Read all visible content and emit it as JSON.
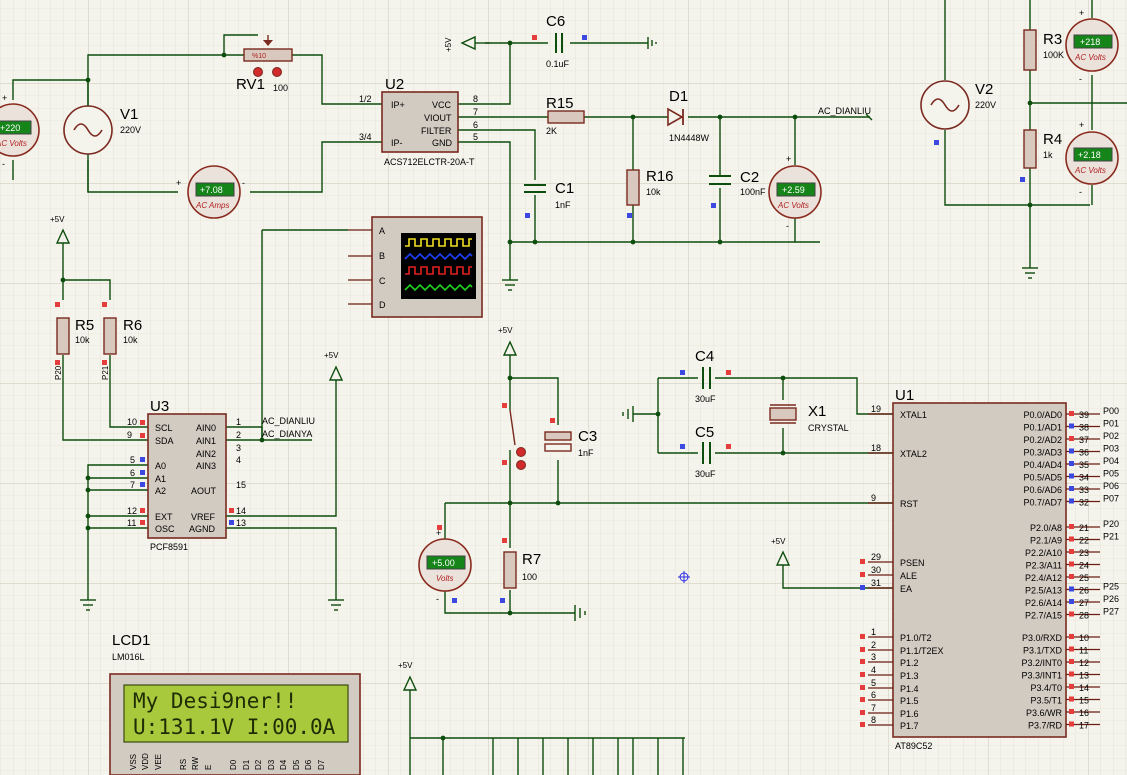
{
  "grid": {
    "minor_color": "#ddd9cc",
    "major_color": "#c9c4b4",
    "background": "#f5f4ec"
  },
  "colors": {
    "wire": "#0d4d0d",
    "component_border": "#7a2a20",
    "component_fill": "#d2cbc2",
    "pin_red": "#e53c3c",
    "pin_blue": "#3b49e0",
    "lcd_green": "#a9c93c",
    "meter_display": "#15851a"
  },
  "u2": {
    "ref": "U2",
    "part": "ACS712ELCTR-20A-T",
    "left_pins": [
      "IP+",
      "IP-"
    ],
    "left_pin_nums": [
      "1/2",
      "3/4"
    ],
    "right_pins": [
      "VCC",
      "VIOUT",
      "FILTER",
      "GND"
    ],
    "right_pin_nums": [
      "8",
      "7",
      "6",
      "5"
    ]
  },
  "u3": {
    "ref": "U3",
    "part": "PCF8591",
    "left_pins": [
      "SCL",
      "SDA",
      "A0",
      "A1",
      "A2",
      "EXT",
      "OSC"
    ],
    "left_pin_nums": [
      "10",
      "9",
      "5",
      "6",
      "7",
      "12",
      "11"
    ],
    "right_pins": [
      "AIN0",
      "AIN1",
      "AIN2",
      "AIN3",
      "AOUT",
      "VREF",
      "AGND"
    ],
    "right_pin_nums": [
      "1",
      "2",
      "3",
      "4",
      "15",
      "14",
      "13"
    ]
  },
  "u1": {
    "ref": "U1",
    "part": "AT89C52",
    "left_pins": [
      "XTAL1",
      "XTAL2",
      "RST",
      "PSEN",
      "ALE",
      "EA",
      "P1.0/T2",
      "P1.1/T2EX",
      "P1.2",
      "P1.3",
      "P1.4",
      "P1.5",
      "P1.6",
      "P1.7"
    ],
    "left_pin_nums": [
      "19",
      "18",
      "9",
      "29",
      "30",
      "31",
      "1",
      "2",
      "3",
      "4",
      "5",
      "6",
      "7",
      "8"
    ],
    "right_pins": [
      "P0.0/AD0",
      "P0.1/AD1",
      "P0.2/AD2",
      "P0.3/AD3",
      "P0.4/AD4",
      "P0.5/AD5",
      "P0.6/AD6",
      "P0.7/AD7",
      "P2.0/A8",
      "P2.1/A9",
      "P2.2/A10",
      "P2.3/A11",
      "P2.4/A12",
      "P2.5/A13",
      "P2.6/A14",
      "P2.7/A15",
      "P3.0/RXD",
      "P3.1/TXD",
      "P3.2/INT0",
      "P3.3/INT1",
      "P3.4/T0",
      "P3.5/T1",
      "P3.6/WR",
      "P3.7/RD"
    ],
    "right_pin_nums": [
      "39",
      "38",
      "37",
      "36",
      "35",
      "34",
      "33",
      "32",
      "21",
      "22",
      "23",
      "24",
      "25",
      "26",
      "27",
      "28",
      "10",
      "11",
      "12",
      "13",
      "14",
      "15",
      "16",
      "17"
    ],
    "net_labels": [
      "P00",
      "P01",
      "P02",
      "P03",
      "P04",
      "P05",
      "P06",
      "P07",
      "P20",
      "P21",
      "P25",
      "P26",
      "P27"
    ]
  },
  "resistors": {
    "rv1": {
      "ref": "RV1",
      "value": "100",
      "body": "%10"
    },
    "r15": {
      "ref": "R15",
      "value": "2K"
    },
    "r16": {
      "ref": "R16",
      "value": "10k"
    },
    "r5": {
      "ref": "R5",
      "value": "10k",
      "net": "P20"
    },
    "r6": {
      "ref": "R6",
      "value": "10k",
      "net": "P21"
    },
    "r7": {
      "ref": "R7",
      "value": "100"
    },
    "r3": {
      "ref": "R3",
      "value": "100K"
    },
    "r4": {
      "ref": "R4",
      "value": "1k"
    }
  },
  "capacitors": {
    "c6": {
      "ref": "C6",
      "value": "0.1uF"
    },
    "c1": {
      "ref": "C1",
      "value": "1nF"
    },
    "c2": {
      "ref": "C2",
      "value": "100nF"
    },
    "c3": {
      "ref": "C3",
      "value": "1nF"
    },
    "c4": {
      "ref": "C4",
      "value": "30uF"
    },
    "c5": {
      "ref": "C5",
      "value": "30uF"
    }
  },
  "d1": {
    "ref": "D1",
    "value": "1N4448W"
  },
  "x1": {
    "ref": "X1",
    "value": "CRYSTAL"
  },
  "sources": {
    "v1": {
      "ref": "V1",
      "value": "220V"
    },
    "v2": {
      "ref": "V2",
      "value": "220V"
    }
  },
  "meters": [
    {
      "id": "m1",
      "reading": "+220",
      "unit": "AC Volts"
    },
    {
      "id": "m2",
      "reading": "+7.08",
      "unit": "AC Amps"
    },
    {
      "id": "m3",
      "reading": "+2.59",
      "unit": "AC Volts"
    },
    {
      "id": "m4",
      "reading": "+5.00",
      "unit": "Volts"
    },
    {
      "id": "m5",
      "reading": "+218",
      "unit": "AC Volts"
    },
    {
      "id": "m6",
      "reading": "+2.18",
      "unit": "AC Volts"
    }
  ],
  "power_labels": {
    "vcc": "+5V"
  },
  "nets": {
    "ac_dianliu": "AC_DIANLIU",
    "ac_dianya": "AC_DIANYA"
  },
  "scope": {
    "channels": [
      "A",
      "B",
      "C",
      "D"
    ]
  },
  "lcd": {
    "ref": "LCD1",
    "part": "LM016L",
    "line1": "My Desi9ner!!",
    "line2": "U:131.1V I:00.0A",
    "pins": [
      "VSS",
      "VDD",
      "VEE",
      "RS",
      "RW",
      "E",
      "D0",
      "D1",
      "D2",
      "D3",
      "D4",
      "D5",
      "D6",
      "D7"
    ]
  },
  "pm": {
    "plus": "+",
    "minus": "-"
  }
}
